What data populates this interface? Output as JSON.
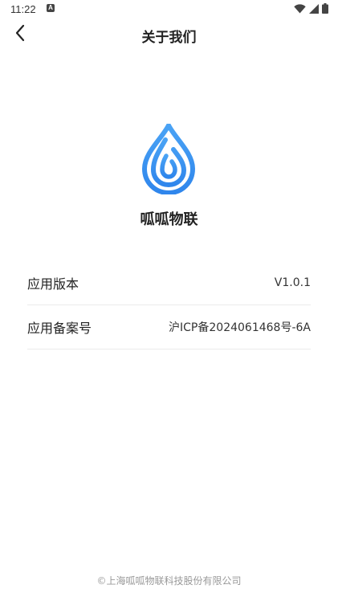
{
  "status_bar": {
    "time": "11:22",
    "notification_letter": "A",
    "icons": [
      "wifi-icon",
      "signal-icon",
      "battery-icon"
    ]
  },
  "nav": {
    "title": "关于我们",
    "back_icon": "chevron-left-icon"
  },
  "app": {
    "name": "呱呱物联",
    "logo_icon": "water-drop-logo",
    "brand_color": "#3a8ff0"
  },
  "info": [
    {
      "label": "应用版本",
      "value": "V1.0.1"
    },
    {
      "label": "应用备案号",
      "value": "沪ICP备2024061468号-6A"
    }
  ],
  "footer": {
    "copyright": "©上海呱呱物联科技股份有限公司"
  }
}
